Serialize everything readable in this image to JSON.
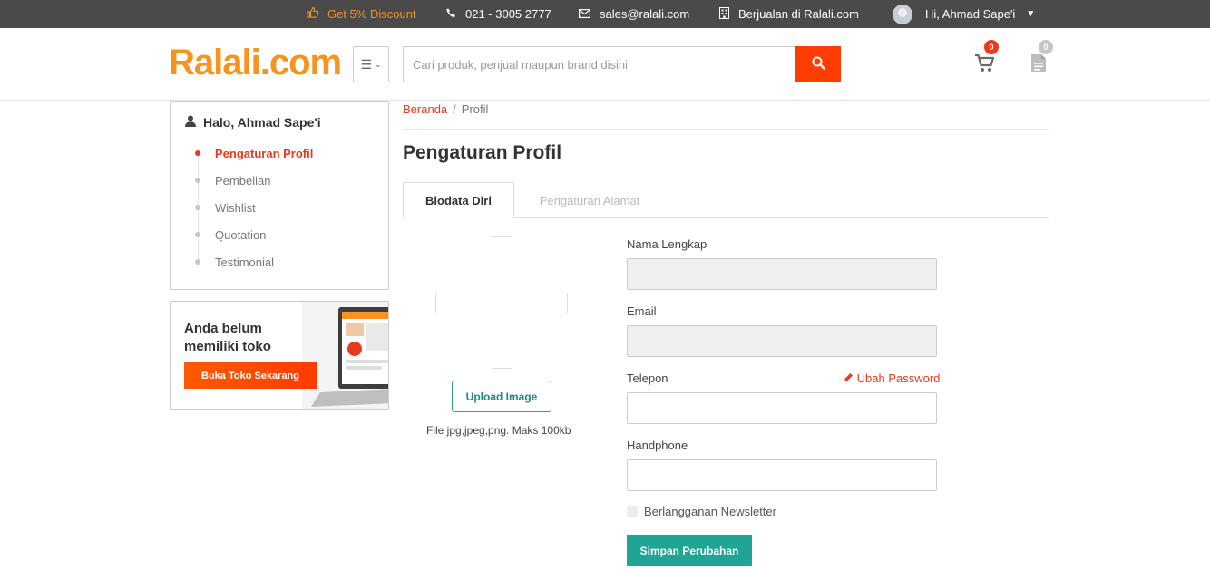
{
  "topbar": {
    "promo": "Get 5% Discount",
    "phone": "021 - 3005 2777",
    "email": "sales@ralali.com",
    "sell": "Berjualan di Ralali.com",
    "user_greeting": "Hi, Ahmad Sape'i"
  },
  "header": {
    "logo": "Ralali.com",
    "search_placeholder": "Cari produk, penjual maupun brand disini",
    "cart_count": "0",
    "quote_count": "0"
  },
  "sidebar": {
    "greeting": "Halo, Ahmad Sape'i",
    "items": [
      {
        "label": "Pengaturan Profil",
        "active": true
      },
      {
        "label": "Pembelian",
        "active": false
      },
      {
        "label": "Wishlist",
        "active": false
      },
      {
        "label": "Quotation",
        "active": false
      },
      {
        "label": "Testimonial",
        "active": false
      }
    ],
    "promo": {
      "title": "Anda belum memiliki toko",
      "button": "Buka Toko  Sekarang"
    }
  },
  "breadcrumb": {
    "home": "Beranda",
    "separator": "/",
    "current": "Profil"
  },
  "page_title": "Pengaturan Profil",
  "tabs": [
    {
      "label": "Biodata Diri",
      "active": true
    },
    {
      "label": "Pengaturan Alamat",
      "active": false
    }
  ],
  "photo": {
    "upload_button": "Upload Image",
    "note": "File jpg,jpeg,png. Maks 100kb"
  },
  "form": {
    "name_label": "Nama Lengkap",
    "name_value": "",
    "email_label": "Email",
    "email_value": "",
    "phone_label": "Telepon",
    "phone_value": "",
    "change_password": "Ubah Password",
    "handphone_label": "Handphone",
    "handphone_value": "",
    "newsletter_label": "Berlangganan Newsletter",
    "save_button": "Simpan Perubahan"
  },
  "colors": {
    "brand_orange": "#f7931e",
    "accent_red": "#ff3d00",
    "teal": "#20a594",
    "topbar": "#4a4a4a"
  }
}
